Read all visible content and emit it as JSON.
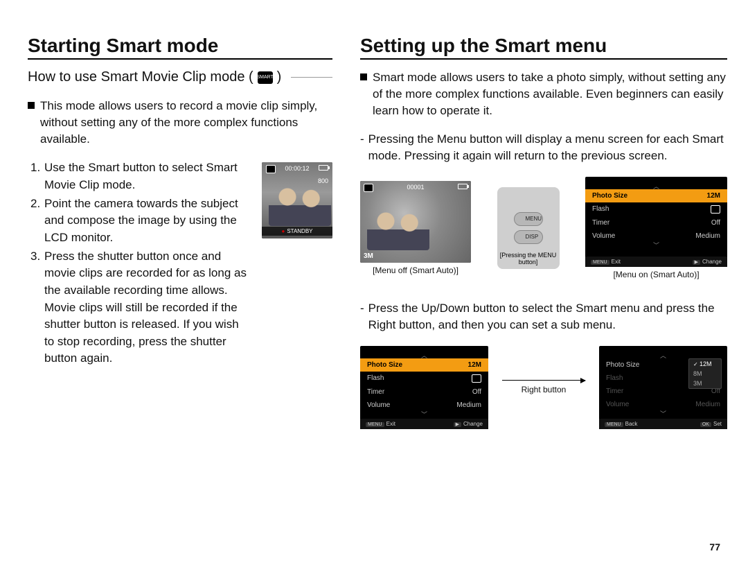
{
  "page_number": "77",
  "left": {
    "title": "Starting Smart mode",
    "subtitle_pre": "How to use Smart Movie Clip mode (",
    "subtitle_post": " )",
    "mode_chip": "SMART",
    "intro": "This mode allows users to record a movie clip simply, without setting any of the more complex functions available.",
    "steps": [
      "Use the Smart button to select Smart Movie Clip mode.",
      "Point the camera towards the subject and compose the image by using the LCD monitor.",
      "Press the shutter button once and movie clips are recorded for as long as the available recording time allows. Movie clips will still be recorded if the shutter button is released. If you wish to stop recording, press the shutter button again."
    ],
    "lcd": {
      "timer": "00:00:12",
      "res": "800",
      "standby": "STANDBY"
    }
  },
  "right": {
    "title": "Setting up the Smart menu",
    "intro": "Smart mode allows users to take a photo simply, without setting any of the more complex functions available. Even beginners can easily learn how to operate it.",
    "note1": "Pressing the Menu button will display a menu screen for each Smart mode. Pressing it again will return to the previous screen.",
    "photo_lcd": {
      "counter": "00001",
      "meg": "3M"
    },
    "camera_buttons": {
      "top": "MENU",
      "bottom": "DISP"
    },
    "camera_caption": "[Pressing the MENU button]",
    "caption_off": "[Menu off (Smart Auto)]",
    "caption_on": "[Menu on (Smart Auto)]",
    "menu_items": [
      {
        "label": "Photo Size",
        "value": "12M"
      },
      {
        "label": "Flash",
        "value": ""
      },
      {
        "label": "Timer",
        "value": "Off"
      },
      {
        "label": "Volume",
        "value": "Medium"
      }
    ],
    "footer_exit": "Exit",
    "footer_change": "Change",
    "footer_back": "Back",
    "footer_set": "Set",
    "note2": "Press the Up/Down button to select the Smart menu and press the Right button, and then you can set a sub menu.",
    "right_button_label": "Right button",
    "submenu": [
      "12M",
      "8M",
      "3M"
    ]
  }
}
